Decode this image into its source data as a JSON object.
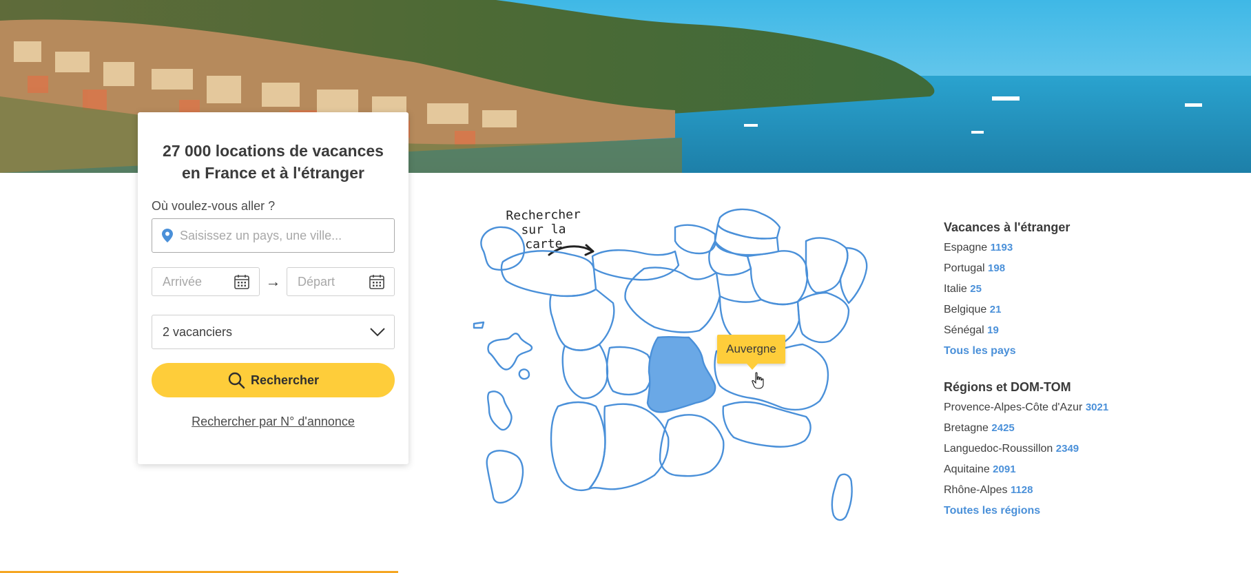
{
  "hero": {
    "image": "riviera-coast-photo"
  },
  "search_card": {
    "title": "27 000 locations de vacances en France et à l'étranger",
    "where_label": "Où voulez-vous aller ?",
    "where_placeholder": "Saisissez un pays, une ville...",
    "arrival_placeholder": "Arrivée",
    "departure_placeholder": "Départ",
    "guests_value": "2 vacanciers",
    "search_button": "Rechercher",
    "ref_link": "Rechercher par N° d'annonce",
    "accent_color": "#fecd3a"
  },
  "map": {
    "hint_line1": "Rechercher",
    "hint_line2": "sur la carte",
    "tooltip": "Auvergne",
    "region_stroke_color": "#4a90d9",
    "highlight_color": "#6aa8e6"
  },
  "abroad": {
    "title": "Vacances à l'étranger",
    "items": [
      {
        "name": "Espagne",
        "count": "1193"
      },
      {
        "name": "Portugal",
        "count": "198"
      },
      {
        "name": "Italie",
        "count": "25"
      },
      {
        "name": "Belgique",
        "count": "21"
      },
      {
        "name": "Sénégal",
        "count": "19"
      }
    ],
    "all_link": "Tous les pays"
  },
  "regions": {
    "title": "Régions et DOM-TOM",
    "items": [
      {
        "name": "Provence-Alpes-Côte d'Azur",
        "count": "3021"
      },
      {
        "name": "Bretagne",
        "count": "2425"
      },
      {
        "name": "Languedoc-Roussillon",
        "count": "2349"
      },
      {
        "name": "Aquitaine",
        "count": "2091"
      },
      {
        "name": "Rhône-Alpes",
        "count": "1128"
      }
    ],
    "all_link": "Toutes les régions"
  }
}
